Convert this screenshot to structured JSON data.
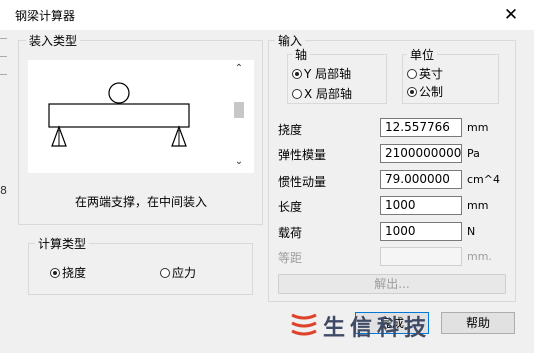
{
  "window": {
    "title": "钢梁计算器",
    "close_glyph": "✕"
  },
  "background_window": {
    "edge_label": "8"
  },
  "load_type": {
    "group_title": "装入类型",
    "description": "在两端支撑，在中间装入",
    "scroll_up_glyph": "⌃",
    "scroll_down_glyph": "⌄"
  },
  "calc_type": {
    "group_title": "计算类型",
    "options": [
      {
        "label": "挠度",
        "checked": true
      },
      {
        "label": "应力",
        "checked": false
      }
    ]
  },
  "input": {
    "group_title": "输入",
    "axis": {
      "title": "轴",
      "options": [
        {
          "label": "Y 局部轴",
          "checked": true
        },
        {
          "label": "X 局部轴",
          "checked": false
        }
      ]
    },
    "unit": {
      "title": "单位",
      "options": [
        {
          "label": "英寸",
          "checked": false
        },
        {
          "label": "公制",
          "checked": true
        }
      ]
    },
    "fields": [
      {
        "label": "挠度",
        "value": "12.557766",
        "unit": "mm",
        "enabled": true
      },
      {
        "label": "弹性模量",
        "value": "2100000000",
        "unit": "Pa",
        "enabled": true
      },
      {
        "label": "惯性动量",
        "value": "79.000000",
        "unit": "cm^4",
        "enabled": true
      },
      {
        "label": "长度",
        "value": "1000",
        "unit": "mm",
        "enabled": true
      },
      {
        "label": "载荷",
        "value": "1000",
        "unit": "N",
        "enabled": true
      },
      {
        "label": "等距",
        "value": "",
        "unit": "mm.",
        "enabled": false
      }
    ],
    "solve_label": "解出..."
  },
  "buttons": {
    "finish": "完成",
    "help": "帮助"
  },
  "watermark": {
    "text": "生信科技",
    "color": "#e0432b"
  }
}
